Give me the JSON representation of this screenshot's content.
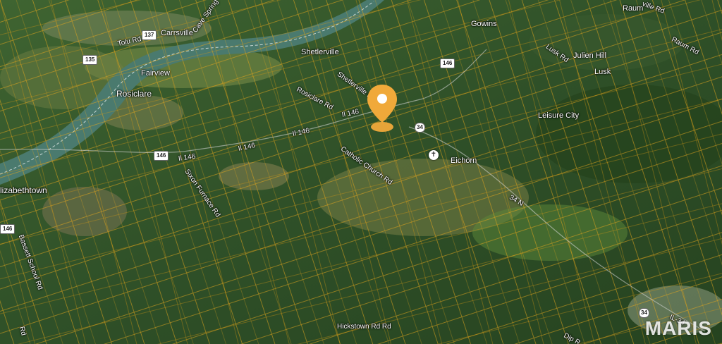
{
  "map": {
    "towns": {
      "rosiclare": "Rosiclare",
      "elizabethtown": "lizabethtown",
      "carrsville": "Carrsville",
      "shetlerville": "Shetlerville",
      "fairview": "Fairview",
      "gowins": "Gowins",
      "julien_hill": "Julien Hill",
      "lusk": "Lusk",
      "leisure_city": "Leisure City",
      "eichorn": "Eichorn",
      "raum": "Raum"
    },
    "roads": {
      "tolu_rd": "Tolu Rd",
      "cave_spring": "Cave Spring",
      "rosiclare_rd": "Rosiclare Rd",
      "shetlerville_rd": "Shetlerville R",
      "il146_a": "Il 146",
      "il146_b": "Il 146",
      "il146_c": "Il 146",
      "il146_d": "Il 146",
      "catholic_church_rd": "Catholic Church Rd",
      "sixon_furnace_rd": "Sixon Furnace Rd",
      "bassett_school_rd": "Bassett School Rd",
      "n34": "34 N",
      "il34": "IL-34",
      "dip_rd": "Dip R",
      "hickstown_rd": "Hickstown Rd Rd",
      "lusk_rd": "Lusk Rd",
      "raum_rd": "Raum Rd",
      "ville_rd": "ville Rd",
      "rd_left": "Rd"
    },
    "shields": {
      "s137": "137",
      "s135": "135",
      "s146_a": "146",
      "s146_b": "146",
      "s146_c": "146",
      "s34_a": "34",
      "s34_b": "34"
    },
    "watermark": "MARIS",
    "colors": {
      "parcel_line": "#e3a51c",
      "pin": "#f0a93a",
      "river": "#4a7a6e",
      "forest": "#2f5028"
    }
  }
}
